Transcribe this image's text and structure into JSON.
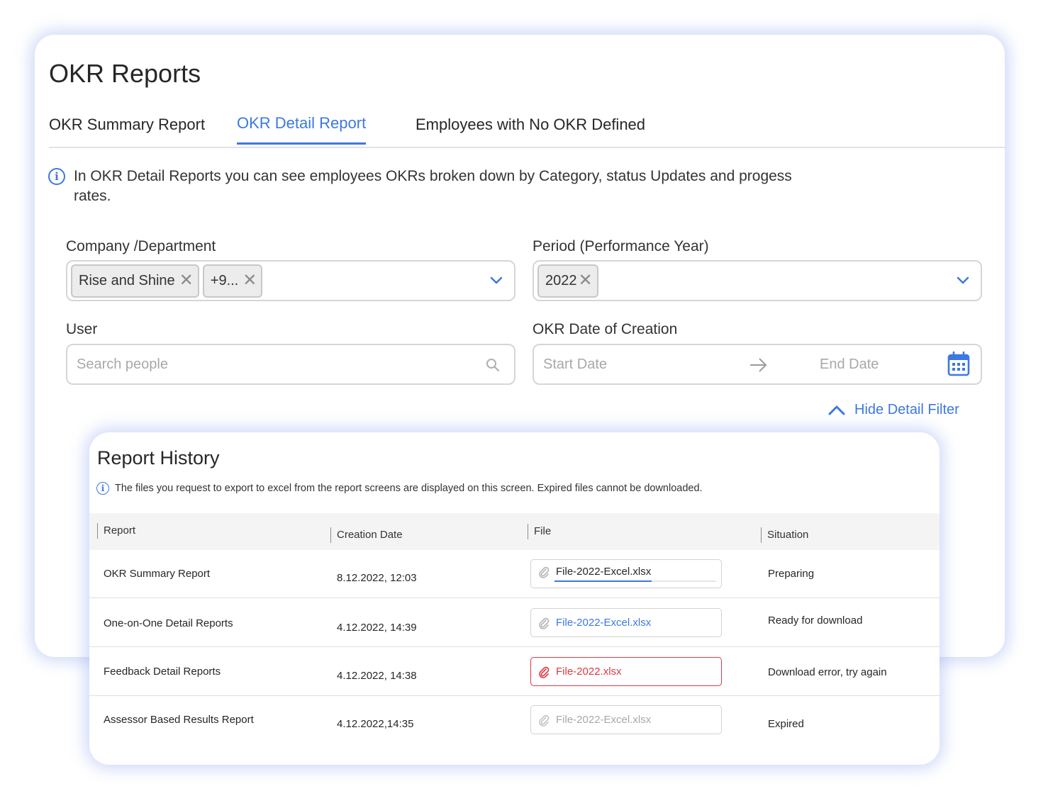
{
  "page_title": "OKR Reports",
  "tabs": [
    {
      "label": "OKR Summary Report",
      "active": false
    },
    {
      "label": "OKR Detail Report",
      "active": true
    },
    {
      "label": "Employees with No OKR Defined",
      "active": false
    }
  ],
  "info_text": "In OKR Detail Reports you can see employees OKRs broken down by Category, status Updates and progess rates.",
  "filters": {
    "company": {
      "label": "Company /Department",
      "chips": [
        "Rise and Shine",
        "+9..."
      ]
    },
    "period": {
      "label": "Period (Performance Year)",
      "chips": [
        "2022"
      ]
    },
    "user": {
      "label": "User",
      "placeholder": "Search people"
    },
    "creation_date": {
      "label": "OKR Date of Creation",
      "start_placeholder": "Start Date",
      "end_placeholder": "End Date"
    },
    "hide_label": "Hide Detail Filter"
  },
  "history": {
    "title": "Report History",
    "info": "The files you request to export to excel from the report screens are displayed on this screen. Expired files cannot be downloaded.",
    "columns": [
      "Report",
      "Creation Date",
      "File",
      "Situation"
    ],
    "rows": [
      {
        "report": "OKR Summary Report",
        "date": "8.12.2022, 12:03",
        "file": "File-2022-Excel.xlsx",
        "situation": "Preparing",
        "state": "preparing",
        "progress": 0.6
      },
      {
        "report": "One-on-One Detail Reports",
        "date": "4.12.2022, 14:39",
        "file": "File-2022-Excel.xlsx",
        "situation": "Ready for download",
        "state": "ready"
      },
      {
        "report": "Feedback Detail Reports",
        "date": "4.12.2022, 14:38",
        "file": "File-2022.xlsx",
        "situation": "Download error, try again",
        "state": "error"
      },
      {
        "report": "Assessor Based Results Report",
        "date": "4.12.2022,14:35",
        "file": "File-2022-Excel.xlsx",
        "situation": "Expired",
        "state": "expired"
      }
    ]
  },
  "colors": {
    "accent": "#3d78e0",
    "error": "#e0393e",
    "muted": "#a8a8a8",
    "text": "#262626"
  }
}
